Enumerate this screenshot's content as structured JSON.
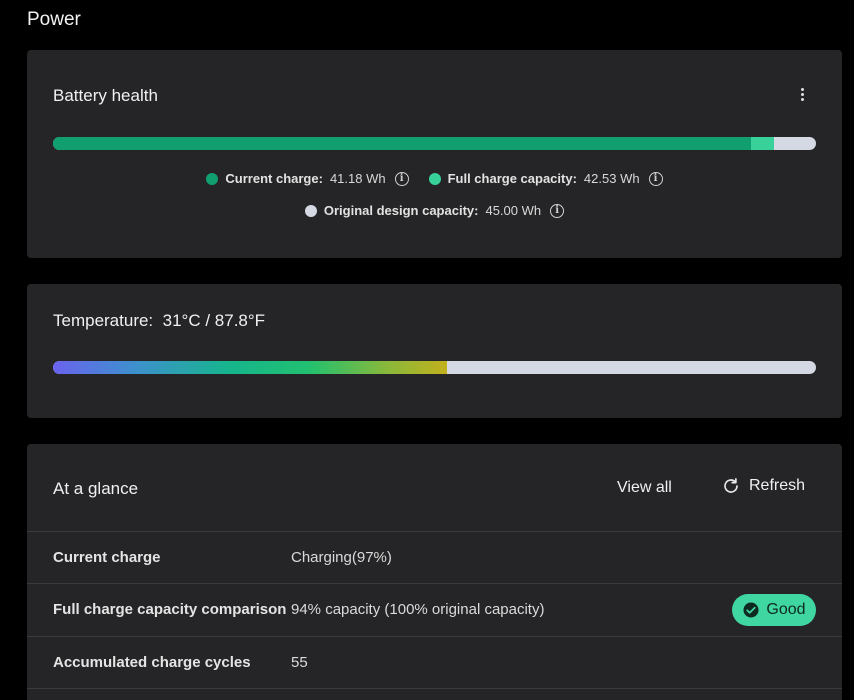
{
  "page": {
    "title": "Power"
  },
  "battery_health": {
    "title": "Battery health",
    "current_charge_wh": 41.18,
    "full_charge_capacity_wh": 42.53,
    "design_capacity_wh": 45.0,
    "legend": {
      "current_label": "Current charge:",
      "current_value": "41.18 Wh",
      "full_label": "Full charge capacity:",
      "full_value": "42.53 Wh",
      "design_label": "Original design capacity:",
      "design_value": "45.00 Wh"
    },
    "colors": {
      "current": "#129f6f",
      "full": "#37d199",
      "design": "#d4d9e3"
    }
  },
  "temperature": {
    "label": "Temperature:",
    "value": "31°C / 87.8°F",
    "level_fraction": 0.517
  },
  "glance": {
    "title": "At a glance",
    "view_all": "View all",
    "refresh": "Refresh",
    "rows": [
      {
        "label": "Current charge",
        "value": "Charging(97%)"
      },
      {
        "label": "Full charge capacity comparison",
        "value": "94% capacity (100% original capacity)",
        "badge": "Good"
      },
      {
        "label": "Accumulated charge cycles",
        "value": "55"
      }
    ]
  },
  "icons": {
    "more": "more-vertical-icon",
    "info": "info-icon",
    "refresh": "refresh-icon",
    "check": "check-circle-icon"
  },
  "info_glyph": "i"
}
